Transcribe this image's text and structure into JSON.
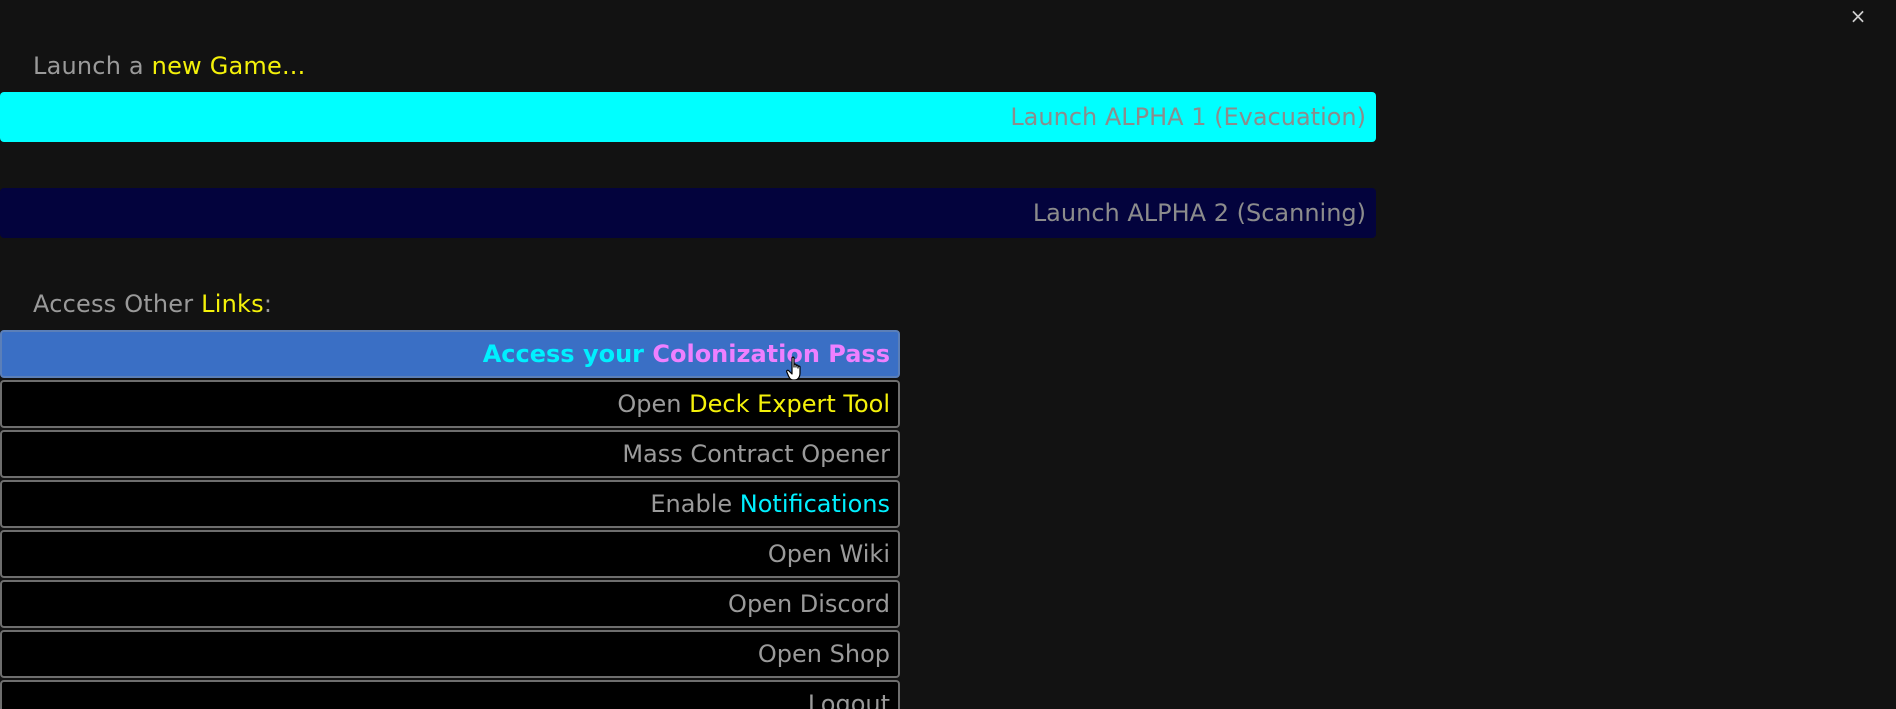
{
  "dialog": {
    "close_label": "×"
  },
  "launch_section": {
    "label_prefix": "Launch a ",
    "label_highlight": "new Game...",
    "buttons": [
      {
        "label": "Launch ALPHA 1 (Evacuation)",
        "background": "#00ffff"
      },
      {
        "label": "Launch ALPHA 2 (Scanning)",
        "background": "#03033d"
      }
    ]
  },
  "links_section": {
    "label_prefix": "Access Other ",
    "label_highlight": "Links",
    "label_suffix": ":",
    "colonization": {
      "part1": "Access your ",
      "part2": "Colonization Pass"
    },
    "deck_expert": {
      "part1": "Open ",
      "part2": "Deck Expert Tool"
    },
    "mass_contract": {
      "label": "Mass Contract Opener"
    },
    "notifications": {
      "part1": "Enable ",
      "part2": "Notifications"
    },
    "wiki": {
      "label": "Open Wiki"
    },
    "discord": {
      "label": "Open Discord"
    },
    "shop": {
      "label": "Open Shop"
    },
    "logout": {
      "label": "Logout"
    }
  },
  "colors": {
    "background": "#121212",
    "highlight_yellow": "#f4f10a",
    "highlight_cyan": "#00f0ff",
    "highlight_pink": "#ee80ff",
    "active_button": "#3a6fc5",
    "text_gray": "#9a9a9a"
  },
  "icons": {
    "close": "close-icon",
    "cursor": "hand-pointer-icon"
  }
}
